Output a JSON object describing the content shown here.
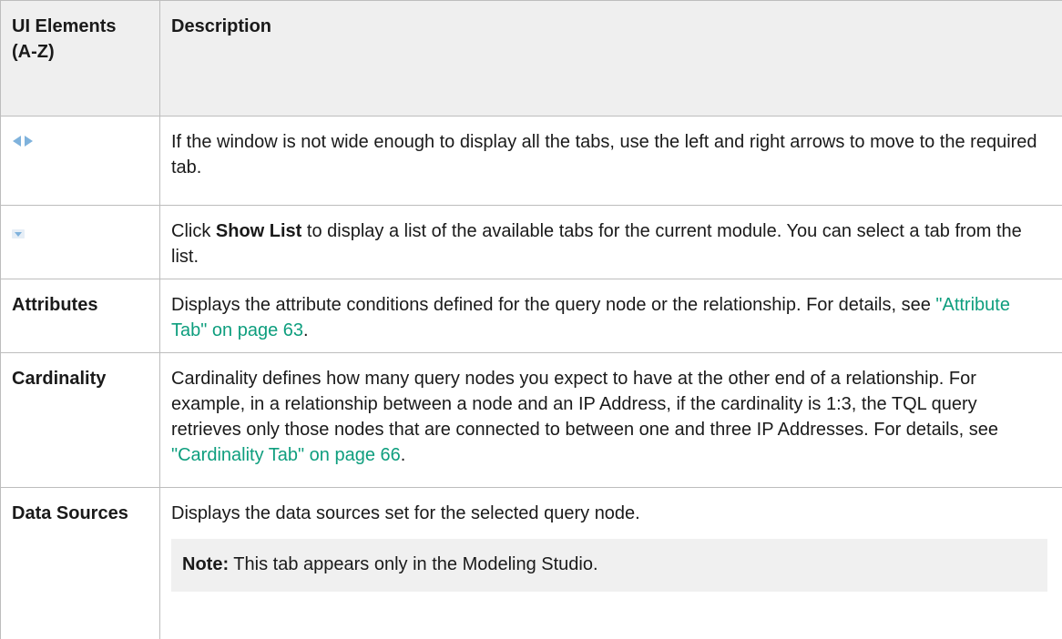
{
  "table": {
    "headers": {
      "col1": "UI Elements (A-Z)",
      "col2": "Description"
    },
    "rows": [
      {
        "icon": "left-right-arrows-icon",
        "desc": "If the window is not wide enough to display all the tabs, use the left and right arrows to move to the required tab."
      },
      {
        "icon": "dropdown-arrow-icon",
        "desc_prefix": "Click ",
        "desc_bold": "Show List",
        "desc_suffix": " to display a list of the available tabs for the current module. You can select a tab from the list."
      },
      {
        "name": "Attributes",
        "desc_prefix": "Displays the attribute conditions defined for the query node or the relationship. For details, see ",
        "link": "\"Attribute Tab\" on page 63",
        "desc_suffix": "."
      },
      {
        "name": "Cardinality",
        "desc_prefix": "Cardinality defines how many query nodes you expect to have at the other end of a relationship. For example, in a relationship between a node and an IP Address, if the cardinality is 1:3, the TQL query retrieves only those nodes that are connected to between one and three IP Addresses. For details, see ",
        "link": "\"Cardinality Tab\" on page 66",
        "desc_suffix": "."
      },
      {
        "name": "Data Sources",
        "desc": "Displays the data sources set for the selected query node.",
        "note_label": "Note:",
        "note_text": " This tab appears only in the Modeling Studio."
      }
    ]
  },
  "colors": {
    "link": "#0e9e7e",
    "icon": "#7fb2dc",
    "header_bg": "#efefef",
    "note_bg": "#f0f0f0"
  }
}
